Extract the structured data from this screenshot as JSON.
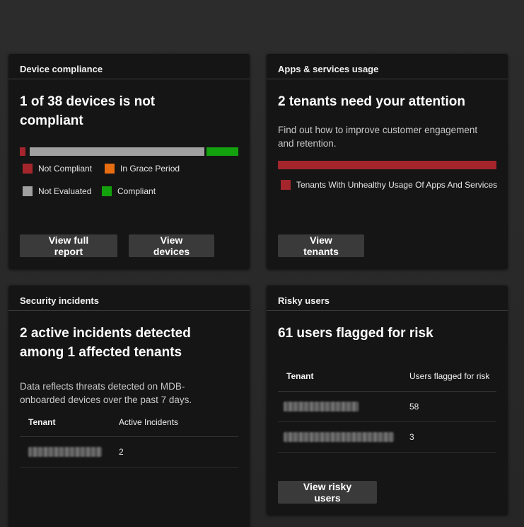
{
  "colors": {
    "not_compliant": "#a4262c",
    "grace_period": "#e86c10",
    "not_evaluated": "#a0a0a0",
    "compliant": "#13a10e",
    "unhealthy": "#a4262c"
  },
  "device_compliance": {
    "header": "Device compliance",
    "title": "1 of 38 devices is not compliant",
    "counts": {
      "not_compliant": 1,
      "not_evaluated": 30,
      "compliant": 7
    },
    "legend": [
      "Not Compliant",
      "In Grace Period",
      "Not Evaluated",
      "Compliant"
    ],
    "buttons": {
      "report": "View full report",
      "devices": "View devices"
    }
  },
  "apps_usage": {
    "header": "Apps & services usage",
    "title": "2 tenants need your attention",
    "description": "Find out how to improve customer engagement and retention.",
    "legend": [
      "Tenants With Unhealthy Usage Of Apps And Services"
    ],
    "button": "View tenants"
  },
  "security_incidents": {
    "header": "Security incidents",
    "title": "2 active incidents detected among 1 affected tenants",
    "description": "Data reflects threats detected on MDB-onboarded devices over the past 7 days.",
    "table": {
      "headers": [
        "Tenant",
        "Active Incidents"
      ],
      "rows": [
        {
          "tenant": "",
          "value": "2"
        }
      ]
    }
  },
  "risky_users": {
    "header": "Risky users",
    "title": "61 users flagged for risk",
    "table": {
      "headers": [
        "Tenant",
        "Users flagged for risk"
      ],
      "rows": [
        {
          "tenant": "",
          "value": "58"
        },
        {
          "tenant": "",
          "value": "3"
        }
      ]
    },
    "button": "View risky users"
  }
}
